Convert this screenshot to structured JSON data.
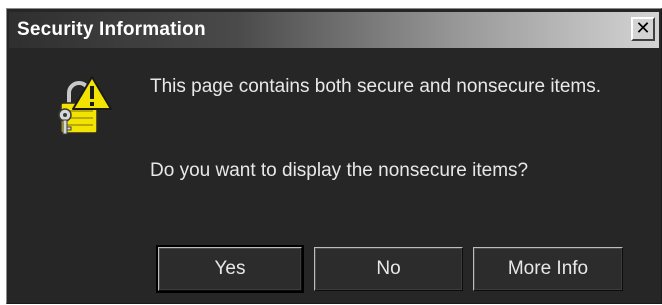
{
  "window": {
    "title": "Security Information",
    "close_glyph": "✕"
  },
  "icon": {
    "name": "lock-warning-icon"
  },
  "message": {
    "text": "This page contains both secure and nonsecure items.",
    "question": "Do you want to display the nonsecure items?"
  },
  "buttons": {
    "yes": "Yes",
    "no": "No",
    "more_info": "More Info"
  },
  "colors": {
    "dialog_bg": "#262626",
    "text": "#e8e8e8",
    "warning_yellow": "#f2e400"
  }
}
